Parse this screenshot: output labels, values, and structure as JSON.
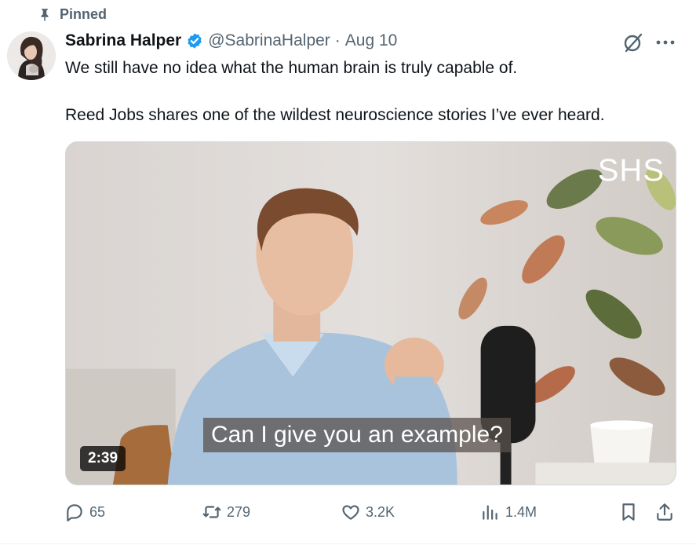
{
  "pinned_label": "Pinned",
  "author": {
    "name": "Sabrina Halper",
    "handle": "@SabrinaHalper",
    "separator": "·",
    "date": "Aug 10",
    "verified": true
  },
  "tweet": {
    "line1": "We still have no idea what the human brain is truly capable of.",
    "line2": "Reed Jobs shares one of the wildest neuroscience stories I’ve ever heard."
  },
  "media": {
    "watermark": "SHS",
    "subtitle": "Can I give you an example?",
    "duration": "2:39"
  },
  "actions": {
    "replies": "65",
    "reposts": "279",
    "likes": "3.2K",
    "views": "1.4M"
  },
  "colors": {
    "text": "#0f1419",
    "secondary": "#536471",
    "verified": "#1d9bf0"
  },
  "icons": [
    "pin-icon",
    "verified-icon",
    "grok-icon",
    "more-icon",
    "reply-icon",
    "repost-icon",
    "like-icon",
    "views-icon",
    "bookmark-icon",
    "share-icon"
  ]
}
